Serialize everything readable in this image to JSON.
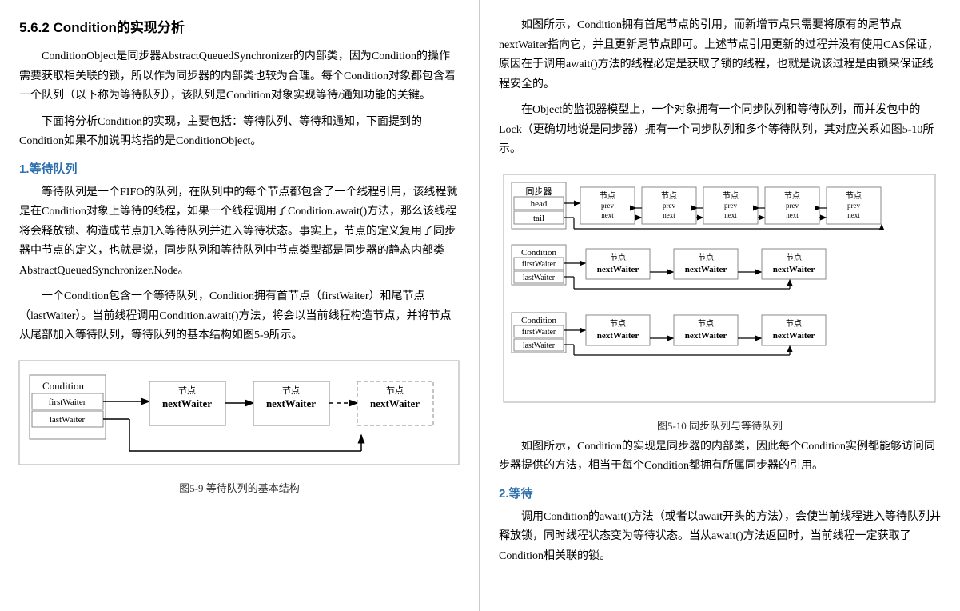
{
  "left": {
    "section_title": "5.6.2  Condition的实现分析",
    "para1": "ConditionObject是同步器AbstractQueuedSynchronizer的内部类，因为Condition的操作需要获取相关联的锁，所以作为同步器的内部类也较为合理。每个Condition对象都包含着一个队列（以下称为等待队列），该队列是Condition对象实现等待/通知功能的关键。",
    "para2": "下面将分析Condition的实现，主要包括：等待队列、等待和通知，下面提到的Condition如果不加说明均指的是ConditionObject。",
    "section1": "1.等待队列",
    "para3": "等待队列是一个FIFO的队列，在队列中的每个节点都包含了一个线程引用，该线程就是在Condition对象上等待的线程，如果一个线程调用了Condition.await()方法，那么该线程将会释放锁、构造成节点加入等待队列并进入等待状态。事实上，节点的定义复用了同步器中节点的定义，也就是说，同步队列和等待队列中节点类型都是同步器的静态内部类AbstractQueuedSynchronizer.Node。",
    "para4": "一个Condition包含一个等待队列，Condition拥有首节点（firstWaiter）和尾节点（lastWaiter）。当前线程调用Condition.await()方法，将会以当前线程构造节点，并将节点从尾部加入等待队列，等待队列的基本结构如图5-9所示。",
    "fig59_caption": "图5-9  等待队列的基本结构",
    "condition_label": "Condition",
    "firstWaiter": "firstWaiter",
    "lastWaiter": "lastWaiter",
    "jiedian": "节点",
    "nextWaiter": "nextWaiter"
  },
  "right": {
    "para1": "如图所示，Condition拥有首尾节点的引用，而新增节点只需要将原有的尾节点nextWaiter指向它，并且更新尾节点即可。上述节点引用更新的过程并没有使用CAS保证，原因在于调用await()方法的线程必定是获取了锁的线程，也就是说该过程是由锁来保证线程安全的。",
    "para2": "在Object的监视器模型上，一个对象拥有一个同步队列和等待队列，而并发包中的Lock（更确切地说是同步器）拥有一个同步队列和多个等待队列，其对应关系如图5-10所示。",
    "fig510_caption": "图5-10  同步队列与等待队列",
    "para3": "如图所示，Condition的实现是同步器的内部类，因此每个Condition实例都能够访问同步器提供的方法，相当于每个Condition都拥有所属同步器的引用。",
    "section2": "2.等待",
    "para4": "调用Condition的await()方法（或者以await开头的方法），会使当前线程进入等待队列并释放锁，同时线程状态变为等待状态。当从await()方法返回时，当前线程一定获取了Condition相关联的锁。",
    "tongbuqi": "同步器",
    "head": "head",
    "tail": "tail",
    "jiedian": "节点",
    "prev": "prev",
    "next": "next"
  }
}
